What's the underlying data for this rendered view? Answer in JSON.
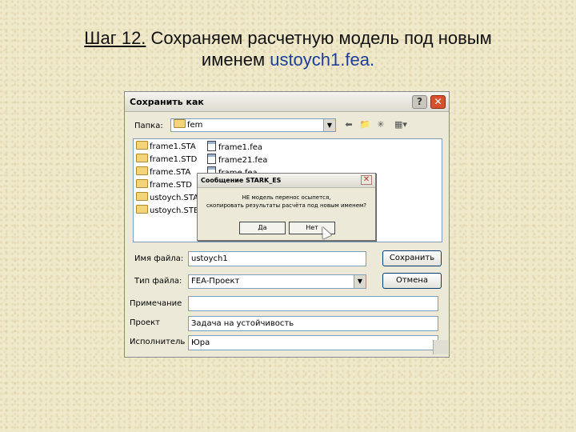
{
  "slide": {
    "title_step": "Шаг 12.",
    "title_rest": " Сохраняем расчетную модель под новым",
    "title_line2_prefix": "именем ",
    "title_filename": "ustoych1.fea",
    "title_dot": "."
  },
  "dialog": {
    "title": "Сохранить как",
    "help_label": "?",
    "close_label": "✕",
    "folder_label": "Папка:",
    "folder_value": "fem",
    "tools": [
      "⬅",
      "📁",
      "✳",
      "▦▾"
    ],
    "left_files": [
      "frame1.STA",
      "frame1.STD",
      "frame.STA",
      "frame.STD",
      "ustoych.STA",
      "ustoych.STB"
    ],
    "right_files": [
      "frame1.fea",
      "frame21.fea",
      "frame.fea"
    ],
    "filename_label": "Имя файла:",
    "filename_value": "ustoych1",
    "filetype_label": "Тип файла:",
    "filetype_value": "FEA-Проект",
    "save_button": "Сохранить",
    "cancel_button": "Отмена",
    "note_label": "Примечание",
    "note_value": "",
    "project_label": "Проект",
    "project_value": "Задача на устойчивость",
    "author_label": "Исполнитель",
    "author_value": "Юра"
  },
  "message": {
    "title": "Сообщение STARK_ES",
    "close_label": "✕",
    "text_line1": "НЕ модель перенос осыпется,",
    "text_line2": "скопировать результаты расчёта под новым именем?",
    "yes_button": "Да",
    "no_button": "Нет"
  }
}
